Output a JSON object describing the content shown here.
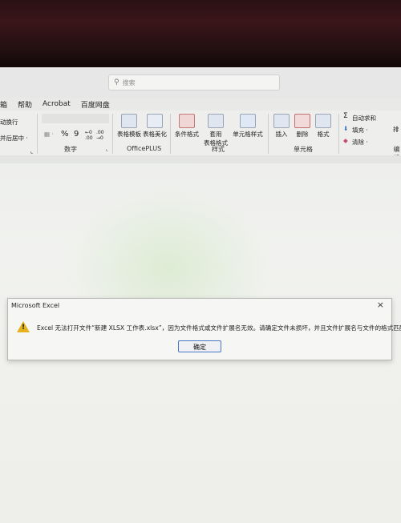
{
  "search": {
    "placeholder": "搜索"
  },
  "menu": {
    "items": [
      "箱",
      "帮助",
      "Acrobat",
      "百度网盘"
    ]
  },
  "ribbon": {
    "wrap_text": "动换行",
    "merge_center": "并后居中 ·",
    "number_group": "数字",
    "percent": "%",
    "comma": "9",
    "table_template": "表格模板",
    "table_beautify": "表格美化",
    "officeplus_group": "OfficePLUS",
    "conditional_format": "条件格式",
    "apply_table_format_1": "套用",
    "apply_table_format_2": "表格格式",
    "cell_styles": "单元格样式",
    "styles_group": "样式",
    "insert": "插入",
    "delete": "删除",
    "format": "格式",
    "cells_group": "单元格",
    "autosum": "自动求和",
    "fill": "填充 ·",
    "clear": "清除 ·",
    "sort": "排",
    "edit_group": "编辑"
  },
  "dialog": {
    "title": "Microsoft Excel",
    "close": "×",
    "message": "Excel 无法打开文件“新建 XLSX 工作表.xlsx”，因为文件格式或文件扩展名无效。请确定文件未损坏，并且文件扩展名与文件的格式匹配。",
    "ok_label": "确定"
  },
  "colors": {
    "warning": "#e5b21d",
    "button_border": "#4b78c6"
  }
}
